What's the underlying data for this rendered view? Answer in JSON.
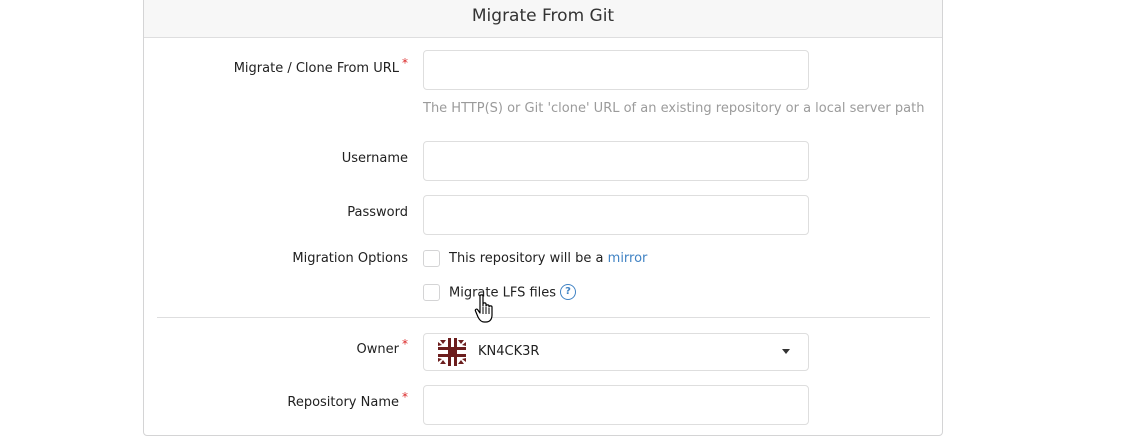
{
  "header": {
    "title": "Migrate From Git"
  },
  "form": {
    "clone_url": {
      "label": "Migrate / Clone From URL",
      "required": "*",
      "value": "",
      "help": "The HTTP(S) or Git 'clone' URL of an existing repository or a local server path"
    },
    "username": {
      "label": "Username",
      "value": ""
    },
    "password": {
      "label": "Password",
      "value": ""
    },
    "migration_options": {
      "label": "Migration Options",
      "mirror": {
        "text": "This repository will be a ",
        "link": "mirror",
        "checked": false
      },
      "lfs": {
        "text": "Migrate LFS files",
        "help_icon": "question-circle-icon",
        "checked": false
      }
    },
    "owner": {
      "label": "Owner",
      "required": "*",
      "selected": "KN4CK3R",
      "avatar_icon": "identicon-avatar"
    },
    "repo_name": {
      "label": "Repository Name",
      "required": "*",
      "value": ""
    }
  },
  "colors": {
    "link": "#4183c4",
    "required": "#db2828",
    "avatar": "#6b1d1d"
  }
}
